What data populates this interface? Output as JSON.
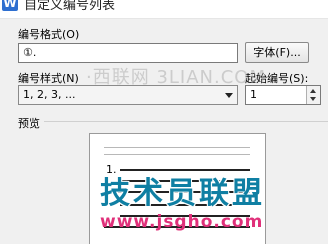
{
  "window": {
    "title": "自定义编号列表",
    "icon": "wps-writer-icon"
  },
  "format": {
    "label": "编号格式(O)",
    "value": "①.",
    "font_button": "字体(F)..."
  },
  "style": {
    "label": "编号样式(N)",
    "selected": "1, 2, 3, ..."
  },
  "start": {
    "label": "起始编号(S):",
    "value": "1"
  },
  "preview": {
    "label": "预览",
    "first_item_number": "1."
  },
  "watermarks": {
    "top": "·西联网 3LIAN.COM",
    "brand": "技术员联盟",
    "url": "www.jsgho.com"
  }
}
